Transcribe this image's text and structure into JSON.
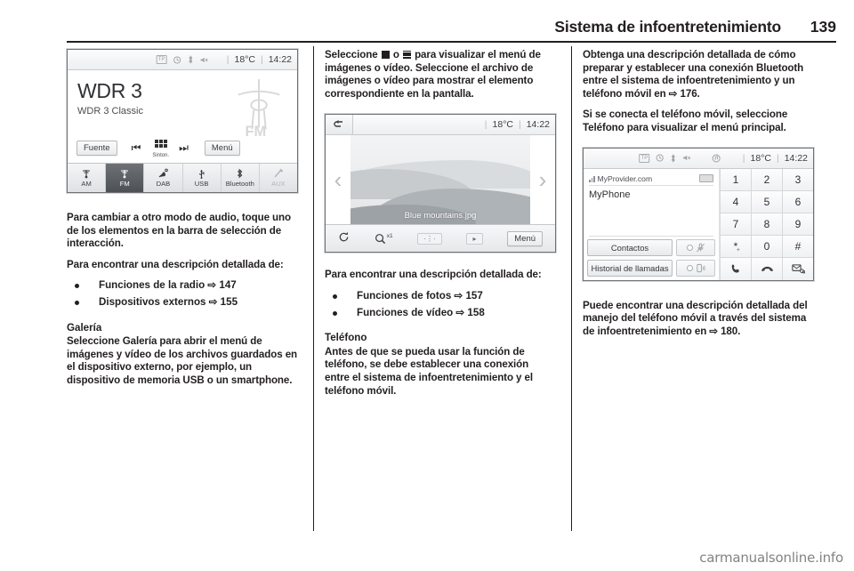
{
  "header": {
    "title": "Sistema de infoentretenimiento",
    "page_number": "139"
  },
  "watermark": "carmanualsonline.info",
  "column1": {
    "radio_screen": {
      "status": {
        "tp": "TP",
        "temperature": "18°C",
        "time": "14:22",
        "icons": [
          "tp-badge-icon",
          "clock-icon",
          "bluetooth-icon",
          "mute-icon"
        ]
      },
      "station_name": "WDR 3",
      "station_info": "WDR 3 Classic",
      "band_logo": "FM",
      "source_button": "Fuente",
      "menu_button": "Menú",
      "tune_label": "Sinton.",
      "tabs": [
        {
          "label": "AM",
          "icon": "antenna-icon",
          "state": "normal"
        },
        {
          "label": "FM",
          "icon": "antenna-icon",
          "state": "active"
        },
        {
          "label": "DAB",
          "icon": "satellite-icon",
          "state": "normal"
        },
        {
          "label": "USB",
          "icon": "usb-icon",
          "state": "normal"
        },
        {
          "label": "Bluetooth",
          "icon": "bluetooth-icon",
          "state": "normal"
        },
        {
          "label": "AUX",
          "icon": "aux-jack-icon",
          "state": "disabled"
        }
      ]
    },
    "para1": "Para cambiar a otro modo de audio, toque uno de los elementos en la barra de selección de interacción.",
    "para2": "Para encontrar una descripción detallada de:",
    "bullets": [
      {
        "text": "Funciones de la radio",
        "arrow": "⇨",
        "page": "147"
      },
      {
        "text": "Dispositivos externos",
        "arrow": "⇨",
        "page": "155"
      }
    ],
    "heading_galeria": "Galería",
    "para3": "Seleccione Galería para abrir el menú de imágenes y vídeo de los archivos guardados en el dispositivo externo, por ejemplo, un dispositivo de memoria USB o un smartphone."
  },
  "column2": {
    "para1_a": "Seleccione",
    "para1_b": "o",
    "para1_c": "para visualizar el menú de imágenes o vídeo. Seleccione el archivo de imágenes o vídeo para mostrar el elemento correspondiente en la pantalla.",
    "inline_icons": [
      "photo-icon",
      "video-icon"
    ],
    "gallery_screen": {
      "back_icon": "back-arrow-icon",
      "temperature": "18°C",
      "time": "14:22",
      "prev_icon": "chevron-left-icon",
      "next_icon": "chevron-right-icon",
      "file_name": "Blue mountains.jpg",
      "tools": [
        {
          "name": "rotate-icon",
          "glyph": "↻"
        },
        {
          "name": "zoom-icon",
          "glyph": "⌕",
          "label": "x1"
        },
        {
          "name": "effects-icon",
          "glyph": "⋯"
        },
        {
          "name": "slideshow-icon",
          "glyph": "▶"
        }
      ],
      "menu_button": "Menú"
    },
    "para2": "Para encontrar una descripción detallada de:",
    "bullets": [
      {
        "text": "Funciones de fotos",
        "arrow": "⇨",
        "page": "157"
      },
      {
        "text": "Funciones de vídeo",
        "arrow": "⇨",
        "page": "158"
      }
    ],
    "heading_telefono": "Teléfono",
    "para3": "Antes de que se pueda usar la función de teléfono, se debe establecer una conexión entre el sistema de infoentretenimiento y el teléfono móvil."
  },
  "column3": {
    "para1": "Obtenga una descripción detallada de cómo preparar y establecer una conexión Bluetooth entre el sistema de infoentretenimiento y un teléfono móvil en ⇨ 176.",
    "para2": "Si se conecta el teléfono móvil, seleccione Teléfono para visualizar el menú principal.",
    "phone_screen": {
      "status": {
        "tp": "TP",
        "temperature": "18°C",
        "time": "14:22",
        "icons": [
          "tp-badge-icon",
          "clock-icon",
          "bluetooth-icon",
          "mute-icon",
          "media-note-icon"
        ]
      },
      "provider": "MyProvider.com",
      "device_name": "MyPhone",
      "contacts_button": "Contactos",
      "call_history_button": "Historial de llamadas",
      "toggle_mute_icon": "mic-mute-icon",
      "toggle_speaker_icon": "speaker-icon",
      "keys": [
        "1",
        "2",
        "3",
        "4",
        "5",
        "6",
        "7",
        "8",
        "9",
        "*",
        "0",
        "#"
      ],
      "star_sub": "+",
      "action_keys": [
        {
          "name": "call-icon",
          "glyph": "✆"
        },
        {
          "name": "end-call-icon",
          "glyph": "⌢"
        },
        {
          "name": "voicemail-icon",
          "glyph": "✉"
        }
      ]
    },
    "para3": "Puede encontrar una descripción detallada del manejo del teléfono móvil a través del sistema de infoentretenimiento en ⇨ 180."
  }
}
